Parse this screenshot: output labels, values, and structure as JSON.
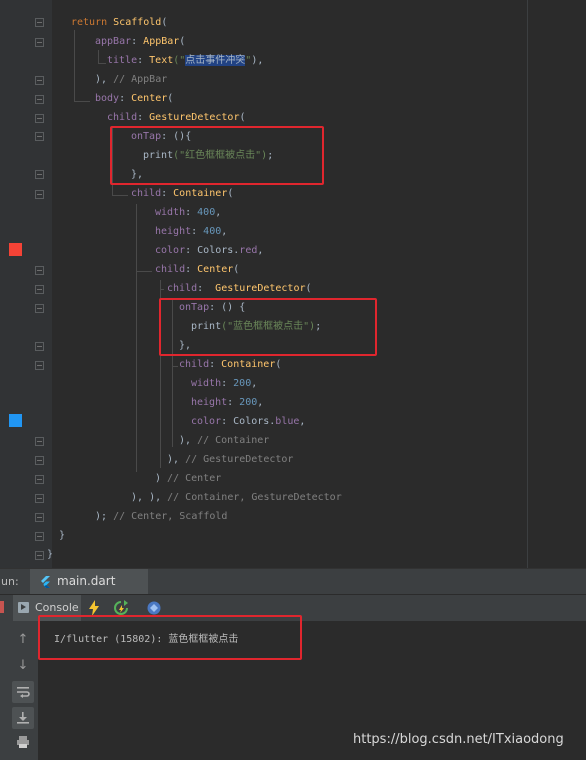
{
  "editor": {
    "lines": [
      [
        [
          "kw",
          "return "
        ],
        [
          "cls",
          "Scaffold"
        ],
        [
          "plain",
          "("
        ]
      ],
      [
        [
          "prop",
          "appBar"
        ],
        [
          "plain",
          ": "
        ],
        [
          "cls",
          "AppBar"
        ],
        [
          "plain",
          "("
        ]
      ],
      [
        [
          "prop",
          "title"
        ],
        [
          "plain",
          ": "
        ],
        [
          "cls",
          "Text"
        ],
        [
          "str",
          "(\""
        ],
        [
          "sel",
          "点击事件冲突"
        ],
        [
          "str",
          "\""
        ],
        [
          "plain",
          "),"
        ]
      ],
      [
        [
          "plain",
          "), "
        ],
        [
          "cmt",
          "// AppBar"
        ]
      ],
      [
        [
          "prop",
          "body"
        ],
        [
          "plain",
          ": "
        ],
        [
          "cls",
          "Center"
        ],
        [
          "plain",
          "("
        ]
      ],
      [
        [
          "prop",
          "child"
        ],
        [
          "plain",
          ": "
        ],
        [
          "cls",
          "GestureDetector"
        ],
        [
          "plain",
          "("
        ]
      ],
      [
        [
          "prop",
          "onTap"
        ],
        [
          "plain",
          ": (){"
        ]
      ],
      [
        [
          "plain",
          "print"
        ],
        [
          "str",
          "(\"红色框框被点击\")"
        ],
        [
          "plain",
          ";"
        ]
      ],
      [
        [
          "plain",
          "},"
        ]
      ],
      [
        [
          "prop",
          "child"
        ],
        [
          "plain",
          ": "
        ],
        [
          "cls",
          "Container"
        ],
        [
          "plain",
          "("
        ]
      ],
      [
        [
          "prop",
          "width"
        ],
        [
          "plain",
          ": "
        ],
        [
          "num",
          "400"
        ],
        [
          "plain",
          ","
        ]
      ],
      [
        [
          "prop",
          "height"
        ],
        [
          "plain",
          ": "
        ],
        [
          "num",
          "400"
        ],
        [
          "plain",
          ","
        ]
      ],
      [
        [
          "prop",
          "color"
        ],
        [
          "plain",
          ": Colors."
        ],
        [
          "prop",
          "red"
        ],
        [
          "plain",
          ","
        ]
      ],
      [
        [
          "prop",
          "child"
        ],
        [
          "plain",
          ": "
        ],
        [
          "cls",
          "Center"
        ],
        [
          "plain",
          "("
        ]
      ],
      [
        [
          "prop",
          "child"
        ],
        [
          "plain",
          ":  "
        ],
        [
          "cls",
          "GestureDetector"
        ],
        [
          "plain",
          "("
        ]
      ],
      [
        [
          "prop",
          "onTap"
        ],
        [
          "plain",
          ": () {"
        ]
      ],
      [
        [
          "plain",
          "print"
        ],
        [
          "str",
          "(\"蓝色框框被点击\")"
        ],
        [
          "plain",
          ";"
        ]
      ],
      [
        [
          "plain",
          "},"
        ]
      ],
      [
        [
          "prop",
          "child"
        ],
        [
          "plain",
          ": "
        ],
        [
          "cls",
          "Container"
        ],
        [
          "plain",
          "("
        ]
      ],
      [
        [
          "prop",
          "width"
        ],
        [
          "plain",
          ": "
        ],
        [
          "num",
          "200"
        ],
        [
          "plain",
          ","
        ]
      ],
      [
        [
          "prop",
          "height"
        ],
        [
          "plain",
          ": "
        ],
        [
          "num",
          "200"
        ],
        [
          "plain",
          ","
        ]
      ],
      [
        [
          "prop",
          "color"
        ],
        [
          "plain",
          ": Colors."
        ],
        [
          "prop",
          "blue"
        ],
        [
          "plain",
          ","
        ]
      ],
      [
        [
          "plain",
          "), "
        ],
        [
          "cmt",
          "// Container"
        ]
      ],
      [
        [
          "plain",
          "), "
        ],
        [
          "cmt",
          "// GestureDetector"
        ]
      ],
      [
        [
          "plain",
          ") "
        ],
        [
          "cmt",
          "// Center"
        ]
      ],
      [
        [
          "plain",
          "), "
        ],
        [
          "plain",
          "), "
        ],
        [
          "cmt",
          "// Container, GestureDetector"
        ]
      ],
      [
        [
          "plain",
          "); "
        ],
        [
          "cmt",
          "// Center, Scaffold"
        ]
      ],
      [
        [
          "plain",
          "}"
        ]
      ],
      [
        [
          "plain",
          "}"
        ]
      ]
    ],
    "swatches": [
      {
        "name": "red",
        "color": "#f44336"
      },
      {
        "name": "blue",
        "color": "#2196f3"
      }
    ]
  },
  "run": {
    "label": "un:",
    "tab_label": "main.dart"
  },
  "toolbar": {
    "console_label": "Console"
  },
  "console": {
    "output": "I/flutter (15802): 蓝色框框被点击"
  },
  "watermark": "https://blog.csdn.net/ITxiaodong",
  "colors": {
    "highlight_box": "#e0262e",
    "background": "#2b2b2b"
  }
}
